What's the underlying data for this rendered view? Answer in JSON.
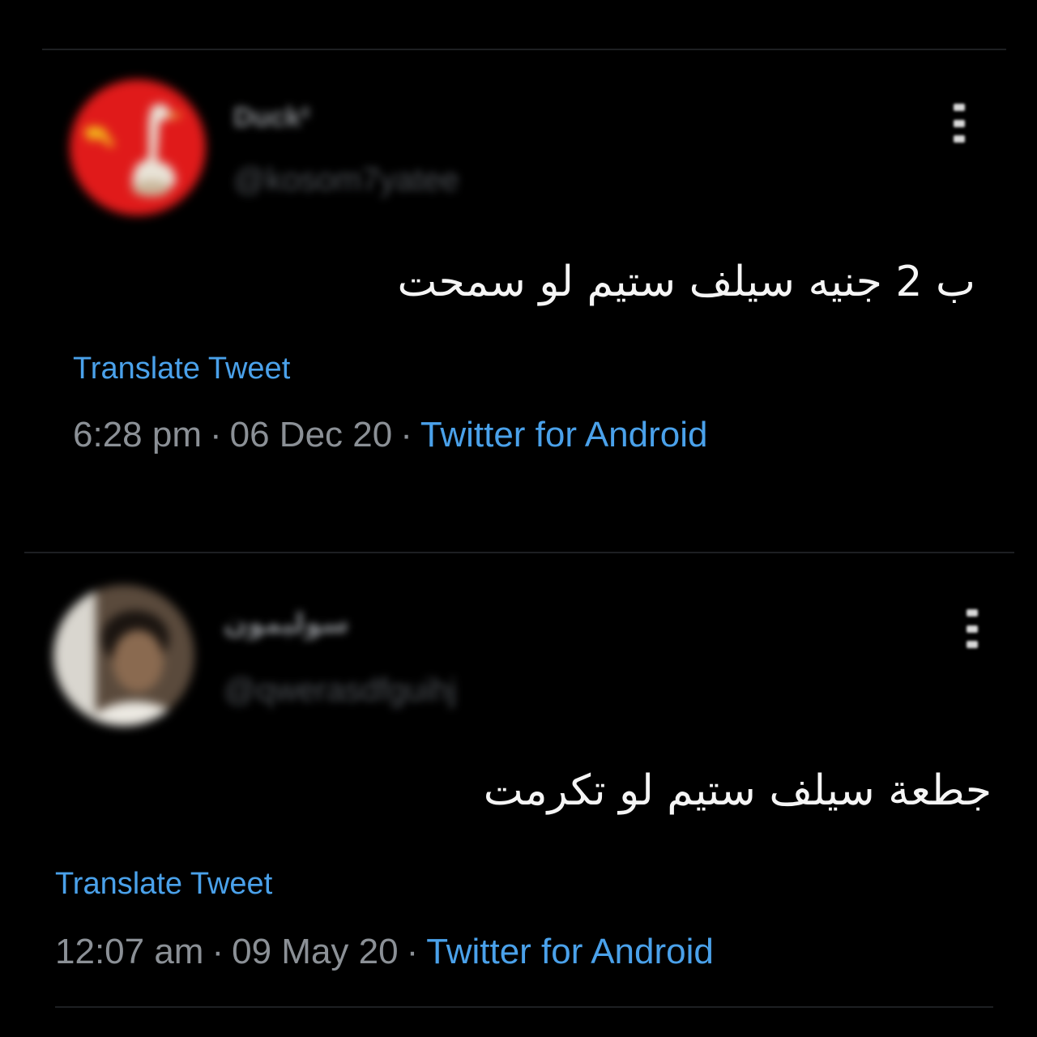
{
  "tweets": [
    {
      "display_name": "Duck²",
      "handle": "@kosom7yatee",
      "text": "ب 2 جنيه سيلف ستيم لو سمحت",
      "translate_label": "Translate Tweet",
      "time": "6:28 pm",
      "date": "06 Dec 20",
      "source": "Twitter for Android",
      "separator": "·",
      "avatar_icon": "duck-hammer-sickle-avatar",
      "more_icon": "more-vertical-icon"
    },
    {
      "display_name": "سوليمون",
      "handle": "@qwerasdfguihj",
      "text": "جطعة سيلف ستيم لو تكرمت",
      "translate_label": "Translate Tweet",
      "time": "12:07 am",
      "date": "09 May 20",
      "source": "Twitter for Android",
      "separator": "·",
      "avatar_icon": "person-photo-avatar",
      "more_icon": "more-vertical-icon"
    }
  ],
  "colors": {
    "background": "#000000",
    "link_blue": "#4aa1ea",
    "meta_gray": "#8b9096",
    "avatar_red": "#e01a1a"
  }
}
